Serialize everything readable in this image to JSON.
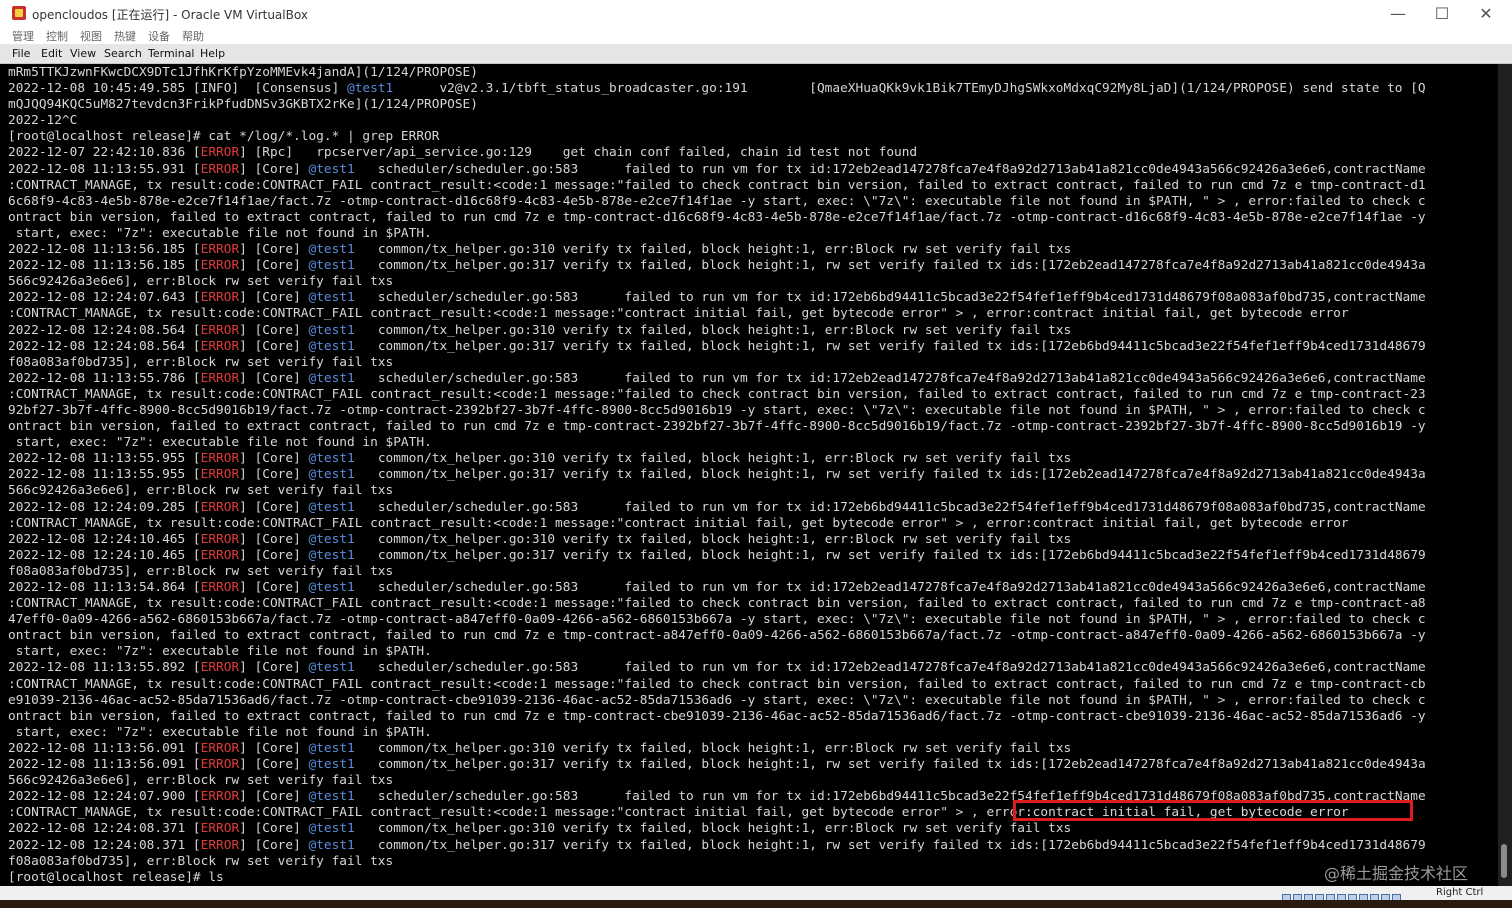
{
  "window": {
    "title": "opencloudos [正在运行] - Oracle VM VirtualBox",
    "buttons": {
      "minimize": "—",
      "maximize": "☐",
      "close": "✕"
    }
  },
  "vbox_menu": [
    "管理",
    "控制",
    "视图",
    "热键",
    "设备",
    "帮助"
  ],
  "terminal_menu": [
    "File",
    "Edit",
    "View",
    "Search",
    "Terminal",
    "Help"
  ],
  "terminal": {
    "lines": [
      [
        {
          "t": "mRm5TTKJzwnFKwcDCX9DTc1JfhKrKfpYzoMMEvk4jandA](1/124/PROPOSE)"
        }
      ],
      [
        {
          "t": "2022-12-08 10:45:49.585 [INFO]  [Consensus] "
        },
        {
          "t": "@test1",
          "c": "user"
        },
        {
          "t": "      v2@v2.3.1/tbft_status_broadcaster.go:191        [QmaeXHuaQKk9vk1Bik7TEmyDJhgSWkxoMdxqC92My8LjaD](1/124/PROPOSE) send state to [Q"
        }
      ],
      [
        {
          "t": "mQJQQ94KQC5uM827tevdcn3FrikPfudDNSv3GKBTX2rKe](1/124/PROPOSE)"
        }
      ],
      [
        {
          "t": "2022-12^C"
        }
      ],
      [
        {
          "t": "[root@localhost release]# cat */log/*.log.* | grep ERROR"
        }
      ],
      [
        {
          "t": "2022-12-07 22:42:10.836 ["
        },
        {
          "t": "ERROR",
          "c": "err"
        },
        {
          "t": "] [Rpc]   rpcserver/api_service.go:129    get chain conf failed, chain id test not found"
        }
      ],
      [
        {
          "t": "2022-12-08 11:13:55.931 ["
        },
        {
          "t": "ERROR",
          "c": "err"
        },
        {
          "t": "] [Core] "
        },
        {
          "t": "@test1",
          "c": "user"
        },
        {
          "t": "   scheduler/scheduler.go:583      failed to run vm for tx id:172eb2ead147278fca7e4f8a92d2713ab41a821cc0de4943a566c92426a3e6e6,contractName"
        }
      ],
      [
        {
          "t": ":CONTRACT_MANAGE, tx result:code:CONTRACT_FAIL contract_result:<code:1 message:\"failed to check contract bin version, failed to extract contract, failed to run cmd 7z e tmp-contract-d1"
        }
      ],
      [
        {
          "t": "6c68f9-4c83-4e5b-878e-e2ce7f14f1ae/fact.7z -otmp-contract-d16c68f9-4c83-4e5b-878e-e2ce7f14f1ae -y start, exec: \\\"7z\\\": executable file not found in $PATH, \" > , error:failed to check c"
        }
      ],
      [
        {
          "t": "ontract bin version, failed to extract contract, failed to run cmd 7z e tmp-contract-d16c68f9-4c83-4e5b-878e-e2ce7f14f1ae/fact.7z -otmp-contract-d16c68f9-4c83-4e5b-878e-e2ce7f14f1ae -y"
        }
      ],
      [
        {
          "t": " start, exec: \"7z\": executable file not found in $PATH."
        }
      ],
      [
        {
          "t": "2022-12-08 11:13:56.185 ["
        },
        {
          "t": "ERROR",
          "c": "err"
        },
        {
          "t": "] [Core] "
        },
        {
          "t": "@test1",
          "c": "user"
        },
        {
          "t": "   common/tx_helper.go:310 verify tx failed, block height:1, err:Block rw set verify fail txs"
        }
      ],
      [
        {
          "t": "2022-12-08 11:13:56.185 ["
        },
        {
          "t": "ERROR",
          "c": "err"
        },
        {
          "t": "] [Core] "
        },
        {
          "t": "@test1",
          "c": "user"
        },
        {
          "t": "   common/tx_helper.go:317 verify tx failed, block height:1, rw set verify failed tx ids:[172eb2ead147278fca7e4f8a92d2713ab41a821cc0de4943a"
        }
      ],
      [
        {
          "t": "566c92426a3e6e6], err:Block rw set verify fail txs"
        }
      ],
      [
        {
          "t": "2022-12-08 12:24:07.643 ["
        },
        {
          "t": "ERROR",
          "c": "err"
        },
        {
          "t": "] [Core] "
        },
        {
          "t": "@test1",
          "c": "user"
        },
        {
          "t": "   scheduler/scheduler.go:583      failed to run vm for tx id:172eb6bd94411c5bcad3e22f54fef1eff9b4ced1731d48679f08a083af0bd735,contractName"
        }
      ],
      [
        {
          "t": ":CONTRACT_MANAGE, tx result:code:CONTRACT_FAIL contract_result:<code:1 message:\"contract initial fail, get bytecode error\" > , error:contract initial fail, get bytecode error"
        }
      ],
      [
        {
          "t": "2022-12-08 12:24:08.564 ["
        },
        {
          "t": "ERROR",
          "c": "err"
        },
        {
          "t": "] [Core] "
        },
        {
          "t": "@test1",
          "c": "user"
        },
        {
          "t": "   common/tx_helper.go:310 verify tx failed, block height:1, err:Block rw set verify fail txs"
        }
      ],
      [
        {
          "t": "2022-12-08 12:24:08.564 ["
        },
        {
          "t": "ERROR",
          "c": "err"
        },
        {
          "t": "] [Core] "
        },
        {
          "t": "@test1",
          "c": "user"
        },
        {
          "t": "   common/tx_helper.go:317 verify tx failed, block height:1, rw set verify failed tx ids:[172eb6bd94411c5bcad3e22f54fef1eff9b4ced1731d48679"
        }
      ],
      [
        {
          "t": "f08a083af0bd735], err:Block rw set verify fail txs"
        }
      ],
      [
        {
          "t": "2022-12-08 11:13:55.786 ["
        },
        {
          "t": "ERROR",
          "c": "err"
        },
        {
          "t": "] [Core] "
        },
        {
          "t": "@test1",
          "c": "user"
        },
        {
          "t": "   scheduler/scheduler.go:583      failed to run vm for tx id:172eb2ead147278fca7e4f8a92d2713ab41a821cc0de4943a566c92426a3e6e6,contractName"
        }
      ],
      [
        {
          "t": ":CONTRACT_MANAGE, tx result:code:CONTRACT_FAIL contract_result:<code:1 message:\"failed to check contract bin version, failed to extract contract, failed to run cmd 7z e tmp-contract-23"
        }
      ],
      [
        {
          "t": "92bf27-3b7f-4ffc-8900-8cc5d9016b19/fact.7z -otmp-contract-2392bf27-3b7f-4ffc-8900-8cc5d9016b19 -y start, exec: \\\"7z\\\": executable file not found in $PATH, \" > , error:failed to check c"
        }
      ],
      [
        {
          "t": "ontract bin version, failed to extract contract, failed to run cmd 7z e tmp-contract-2392bf27-3b7f-4ffc-8900-8cc5d9016b19/fact.7z -otmp-contract-2392bf27-3b7f-4ffc-8900-8cc5d9016b19 -y"
        }
      ],
      [
        {
          "t": " start, exec: \"7z\": executable file not found in $PATH."
        }
      ],
      [
        {
          "t": "2022-12-08 11:13:55.955 ["
        },
        {
          "t": "ERROR",
          "c": "err"
        },
        {
          "t": "] [Core] "
        },
        {
          "t": "@test1",
          "c": "user"
        },
        {
          "t": "   common/tx_helper.go:310 verify tx failed, block height:1, err:Block rw set verify fail txs"
        }
      ],
      [
        {
          "t": "2022-12-08 11:13:55.955 ["
        },
        {
          "t": "ERROR",
          "c": "err"
        },
        {
          "t": "] [Core] "
        },
        {
          "t": "@test1",
          "c": "user"
        },
        {
          "t": "   common/tx_helper.go:317 verify tx failed, block height:1, rw set verify failed tx ids:[172eb2ead147278fca7e4f8a92d2713ab41a821cc0de4943a"
        }
      ],
      [
        {
          "t": "566c92426a3e6e6], err:Block rw set verify fail txs"
        }
      ],
      [
        {
          "t": "2022-12-08 12:24:09.285 ["
        },
        {
          "t": "ERROR",
          "c": "err"
        },
        {
          "t": "] [Core] "
        },
        {
          "t": "@test1",
          "c": "user"
        },
        {
          "t": "   scheduler/scheduler.go:583      failed to run vm for tx id:172eb6bd94411c5bcad3e22f54fef1eff9b4ced1731d48679f08a083af0bd735,contractName"
        }
      ],
      [
        {
          "t": ":CONTRACT_MANAGE, tx result:code:CONTRACT_FAIL contract_result:<code:1 message:\"contract initial fail, get bytecode error\" > , error:contract initial fail, get bytecode error"
        }
      ],
      [
        {
          "t": "2022-12-08 12:24:10.465 ["
        },
        {
          "t": "ERROR",
          "c": "err"
        },
        {
          "t": "] [Core] "
        },
        {
          "t": "@test1",
          "c": "user"
        },
        {
          "t": "   common/tx_helper.go:310 verify tx failed, block height:1, err:Block rw set verify fail txs"
        }
      ],
      [
        {
          "t": "2022-12-08 12:24:10.465 ["
        },
        {
          "t": "ERROR",
          "c": "err"
        },
        {
          "t": "] [Core] "
        },
        {
          "t": "@test1",
          "c": "user"
        },
        {
          "t": "   common/tx_helper.go:317 verify tx failed, block height:1, rw set verify failed tx ids:[172eb6bd94411c5bcad3e22f54fef1eff9b4ced1731d48679"
        }
      ],
      [
        {
          "t": "f08a083af0bd735], err:Block rw set verify fail txs"
        }
      ],
      [
        {
          "t": "2022-12-08 11:13:54.864 ["
        },
        {
          "t": "ERROR",
          "c": "err"
        },
        {
          "t": "] [Core] "
        },
        {
          "t": "@test1",
          "c": "user"
        },
        {
          "t": "   scheduler/scheduler.go:583      failed to run vm for tx id:172eb2ead147278fca7e4f8a92d2713ab41a821cc0de4943a566c92426a3e6e6,contractName"
        }
      ],
      [
        {
          "t": ":CONTRACT_MANAGE, tx result:code:CONTRACT_FAIL contract_result:<code:1 message:\"failed to check contract bin version, failed to extract contract, failed to run cmd 7z e tmp-contract-a8"
        }
      ],
      [
        {
          "t": "47eff0-0a09-4266-a562-6860153b667a/fact.7z -otmp-contract-a847eff0-0a09-4266-a562-6860153b667a -y start, exec: \\\"7z\\\": executable file not found in $PATH, \" > , error:failed to check c"
        }
      ],
      [
        {
          "t": "ontract bin version, failed to extract contract, failed to run cmd 7z e tmp-contract-a847eff0-0a09-4266-a562-6860153b667a/fact.7z -otmp-contract-a847eff0-0a09-4266-a562-6860153b667a -y"
        }
      ],
      [
        {
          "t": " start, exec: \"7z\": executable file not found in $PATH."
        }
      ],
      [
        {
          "t": "2022-12-08 11:13:55.892 ["
        },
        {
          "t": "ERROR",
          "c": "err"
        },
        {
          "t": "] [Core] "
        },
        {
          "t": "@test1",
          "c": "user"
        },
        {
          "t": "   scheduler/scheduler.go:583      failed to run vm for tx id:172eb2ead147278fca7e4f8a92d2713ab41a821cc0de4943a566c92426a3e6e6,contractName"
        }
      ],
      [
        {
          "t": ":CONTRACT_MANAGE, tx result:code:CONTRACT_FAIL contract_result:<code:1 message:\"failed to check contract bin version, failed to extract contract, failed to run cmd 7z e tmp-contract-cb"
        }
      ],
      [
        {
          "t": "e91039-2136-46ac-ac52-85da71536ad6/fact.7z -otmp-contract-cbe91039-2136-46ac-ac52-85da71536ad6 -y start, exec: \\\"7z\\\": executable file not found in $PATH, \" > , error:failed to check c"
        }
      ],
      [
        {
          "t": "ontract bin version, failed to extract contract, failed to run cmd 7z e tmp-contract-cbe91039-2136-46ac-ac52-85da71536ad6/fact.7z -otmp-contract-cbe91039-2136-46ac-ac52-85da71536ad6 -y"
        }
      ],
      [
        {
          "t": " start, exec: \"7z\": executable file not found in $PATH."
        }
      ],
      [
        {
          "t": "2022-12-08 11:13:56.091 ["
        },
        {
          "t": "ERROR",
          "c": "err"
        },
        {
          "t": "] [Core] "
        },
        {
          "t": "@test1",
          "c": "user"
        },
        {
          "t": "   common/tx_helper.go:310 verify tx failed, block height:1, err:Block rw set verify fail txs"
        }
      ],
      [
        {
          "t": "2022-12-08 11:13:56.091 ["
        },
        {
          "t": "ERROR",
          "c": "err"
        },
        {
          "t": "] [Core] "
        },
        {
          "t": "@test1",
          "c": "user"
        },
        {
          "t": "   common/tx_helper.go:317 verify tx failed, block height:1, rw set verify failed tx ids:[172eb2ead147278fca7e4f8a92d2713ab41a821cc0de4943a"
        }
      ],
      [
        {
          "t": "566c92426a3e6e6], err:Block rw set verify fail txs"
        }
      ],
      [
        {
          "t": "2022-12-08 12:24:07.900 ["
        },
        {
          "t": "ERROR",
          "c": "err"
        },
        {
          "t": "] [Core] "
        },
        {
          "t": "@test1",
          "c": "user"
        },
        {
          "t": "   scheduler/scheduler.go:583      failed to run vm for tx id:172eb6bd94411c5bcad3e22f54fef1eff9b4ced1731d48679f08a083af0bd735,contractName"
        }
      ],
      [
        {
          "t": ":CONTRACT_MANAGE, tx result:code:CONTRACT_FAIL contract_result:<code:1 message:\"contract initial fail, get bytecode error\" > , error:contract initial fail, get bytecode error"
        }
      ],
      [
        {
          "t": "2022-12-08 12:24:08.371 ["
        },
        {
          "t": "ERROR",
          "c": "err"
        },
        {
          "t": "] [Core] "
        },
        {
          "t": "@test1",
          "c": "user"
        },
        {
          "t": "   common/tx_helper.go:310 verify tx failed, block height:1, err:Block rw set verify fail txs"
        }
      ],
      [
        {
          "t": "2022-12-08 12:24:08.371 ["
        },
        {
          "t": "ERROR",
          "c": "err"
        },
        {
          "t": "] [Core] "
        },
        {
          "t": "@test1",
          "c": "user"
        },
        {
          "t": "   common/tx_helper.go:317 verify tx failed, block height:1, rw set verify failed tx ids:[172eb6bd94411c5bcad3e22f54fef1eff9b4ced1731d48679"
        }
      ],
      [
        {
          "t": "f08a083af0bd735], err:Block rw set verify fail txs"
        }
      ],
      [
        {
          "t": "[root@localhost release]# ls"
        }
      ]
    ],
    "colors": {
      "text": "#d6d6d6",
      "error_tag": "#e03b3b",
      "user_tag": "#5b8bd9",
      "highlight_box": "#e01b1b"
    }
  },
  "watermark": "@稀土掘金技术社区",
  "statusbar": {
    "host_key": "Right Ctrl"
  }
}
